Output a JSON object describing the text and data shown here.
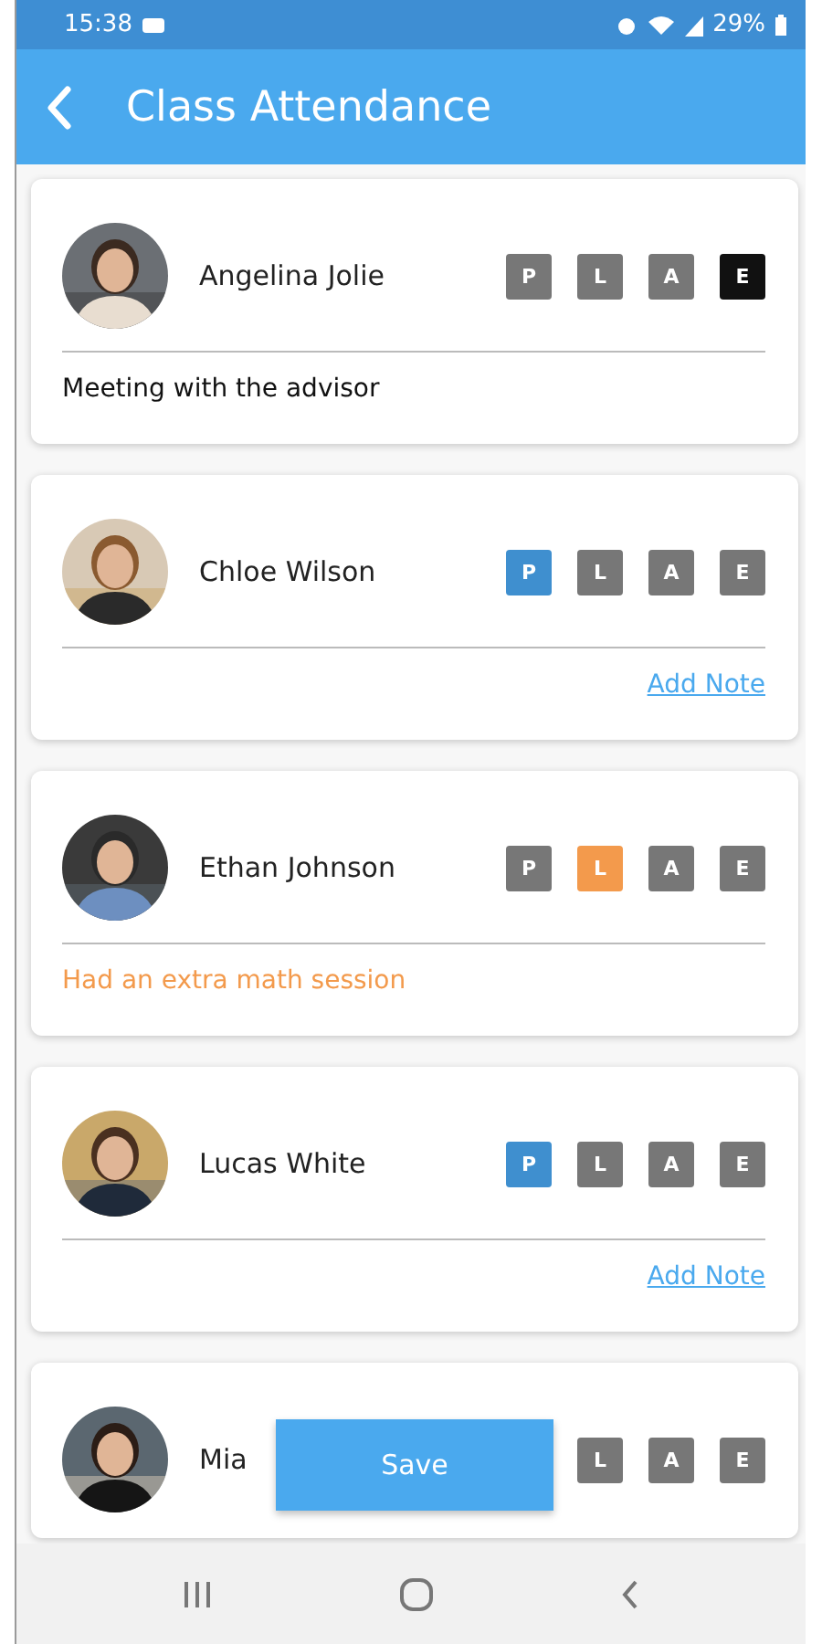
{
  "status_bar": {
    "time": "15:38",
    "battery": "29%"
  },
  "app_bar": {
    "title": "Class Attendance"
  },
  "students": [
    {
      "name": "Angelina Jolie",
      "statuses": [
        {
          "label": "P",
          "selected": false
        },
        {
          "label": "L",
          "selected": false
        },
        {
          "label": "A",
          "selected": false
        },
        {
          "label": "E",
          "selected": true
        }
      ],
      "note": {
        "kind": "text",
        "text": "Meeting with the advisor"
      }
    },
    {
      "name": "Chloe Wilson",
      "statuses": [
        {
          "label": "P",
          "selected": true
        },
        {
          "label": "L",
          "selected": false
        },
        {
          "label": "A",
          "selected": false
        },
        {
          "label": "E",
          "selected": false
        }
      ],
      "note": {
        "kind": "link",
        "text": "Add Note"
      }
    },
    {
      "name": "Ethan Johnson",
      "statuses": [
        {
          "label": "P",
          "selected": false
        },
        {
          "label": "L",
          "selected": true
        },
        {
          "label": "A",
          "selected": false
        },
        {
          "label": "E",
          "selected": false
        }
      ],
      "note": {
        "kind": "text",
        "text": "Had an extra math session"
      }
    },
    {
      "name": "Lucas White",
      "statuses": [
        {
          "label": "P",
          "selected": true
        },
        {
          "label": "L",
          "selected": false
        },
        {
          "label": "A",
          "selected": false
        },
        {
          "label": "E",
          "selected": false
        }
      ],
      "note": {
        "kind": "link",
        "text": "Add Note"
      }
    },
    {
      "name": "Mia",
      "statuses": [
        {
          "label": "L",
          "selected": false
        },
        {
          "label": "A",
          "selected": false
        },
        {
          "label": "E",
          "selected": false
        }
      ]
    }
  ],
  "save_button": "Save"
}
